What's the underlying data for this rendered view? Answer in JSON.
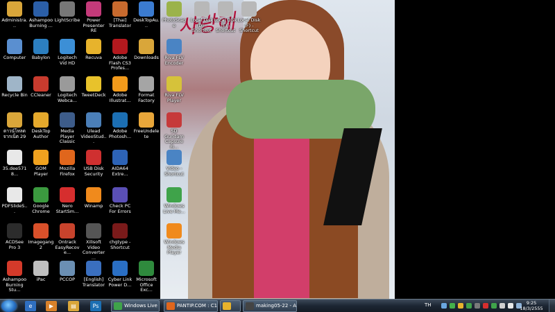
{
  "wallpaper": {
    "script_text": "사랑해"
  },
  "desktop_icons": [
    {
      "label": "Administra...",
      "icon": "folder-icon",
      "color": "#d9a63a"
    },
    {
      "label": "Computer",
      "icon": "computer-icon",
      "color": "#5a8fd0"
    },
    {
      "label": "Recycle Bin",
      "icon": "recycle-bin-icon",
      "color": "#9fb5c8"
    },
    {
      "label": "ดาวน์โหลดจากเน็ต 29",
      "icon": "folder-icon",
      "color": "#d9a63a"
    },
    {
      "label": "35.dee5718...",
      "icon": "document-icon",
      "color": "#e8e8e8"
    },
    {
      "label": "PDFSlideS...",
      "icon": "document-icon",
      "color": "#e8e8e8"
    },
    {
      "label": "ACDSee Pro 3",
      "icon": "acdsee-icon",
      "color": "#2c2c2c"
    },
    {
      "label": "Ashampoo Burning Stu...",
      "icon": "ashampoo-icon",
      "color": "#d43a2a"
    },
    {
      "label": "Ashampoo Burning ...",
      "icon": "ashampoo-icon",
      "color": "#2b5fa8"
    },
    {
      "label": "Babylon",
      "icon": "babylon-icon",
      "color": "#2c7fc0"
    },
    {
      "label": "CCleaner",
      "icon": "ccleaner-icon",
      "color": "#c83b2e"
    },
    {
      "label": "DeskTop Author",
      "icon": "desktop-author-icon",
      "color": "#e5a92c"
    },
    {
      "label": "GOM Player",
      "icon": "gom-player-icon",
      "color": "#f0a21f"
    },
    {
      "label": "Google Chrome",
      "icon": "chrome-icon",
      "color": "#3b9a3f"
    },
    {
      "label": "Imagegang2",
      "icon": "imagegang-icon",
      "color": "#d9502a"
    },
    {
      "label": "iPac",
      "icon": "ipac-icon",
      "color": "#bfbfbf"
    },
    {
      "label": "LightScribe",
      "icon": "lightscribe-icon",
      "color": "#777777"
    },
    {
      "label": "Logitech Vid HD",
      "icon": "logitech-icon",
      "color": "#3c8fd6"
    },
    {
      "label": "Logitech Webca...",
      "icon": "webcam-icon",
      "color": "#9a9a9a"
    },
    {
      "label": "Media Player Classic",
      "icon": "media-player-icon",
      "color": "#3d5c8a"
    },
    {
      "label": "Mozilla Firefox",
      "icon": "firefox-icon",
      "color": "#e0661c"
    },
    {
      "label": "Nero StartSm...",
      "icon": "nero-icon",
      "color": "#d62e2e"
    },
    {
      "label": "Ontrack EasyRecove...",
      "icon": "ontrack-icon",
      "color": "#c7432c"
    },
    {
      "label": "PCCOP",
      "icon": "pccop-icon",
      "color": "#6b8fb3"
    },
    {
      "label": "Power Presenter RE",
      "icon": "presenter-icon",
      "color": "#c43a7a"
    },
    {
      "label": "Recuva",
      "icon": "recuva-icon",
      "color": "#e7b32c"
    },
    {
      "label": "TweetDeck",
      "icon": "tweetdeck-icon",
      "color": "#e8c22b"
    },
    {
      "label": "Ulead VideoStud...",
      "icon": "ulead-icon",
      "color": "#4b7fb8"
    },
    {
      "label": "USB Disk Security",
      "icon": "usb-security-icon",
      "color": "#cf3030"
    },
    {
      "label": "Winamp",
      "icon": "winamp-icon",
      "color": "#f08a1c"
    },
    {
      "label": "Xilisoft Video Converter ...",
      "icon": "xilisoft-icon",
      "color": "#555555"
    },
    {
      "label": "[English] Translator",
      "icon": "translator-icon",
      "color": "#3a6fbf"
    },
    {
      "label": "[Thai] Translator",
      "icon": "translator-icon",
      "color": "#c86a2e"
    },
    {
      "label": "Adobe Flash CS3 Profes...",
      "icon": "flash-icon",
      "color": "#b3191e"
    },
    {
      "label": "Adobe Illustrat...",
      "icon": "illustrator-icon",
      "color": "#f29a1b"
    },
    {
      "label": "Adobe Photosh...",
      "icon": "photoshop-icon",
      "color": "#1c6fb3"
    },
    {
      "label": "AIDA64 Extre...",
      "icon": "aida64-icon",
      "color": "#2d63b6"
    },
    {
      "label": "Check PC For Errors",
      "icon": "checkpc-icon",
      "color": "#5a4fb5"
    },
    {
      "label": "chgtype - Shortcut",
      "icon": "chgtype-icon",
      "color": "#7a1a1a"
    },
    {
      "label": "Cyber Link Power D...",
      "icon": "cyberlink-icon",
      "color": "#2a6fc4"
    },
    {
      "label": "DeskTopAu...",
      "icon": "desktop-author-icon",
      "color": "#3b7bd0"
    },
    {
      "label": "Downloads",
      "icon": "folder-icon",
      "color": "#d9a63a"
    },
    {
      "label": "Format Factory",
      "icon": "format-factory-icon",
      "color": "#a5a5a5"
    },
    {
      "label": "FreeUndelete",
      "icon": "freeundelete-icon",
      "color": "#e8a63a"
    },
    {
      "label": "Microsoft Office Exc...",
      "icon": "excel-icon",
      "color": "#2f8a3d"
    },
    {
      "label": "PhotoScape",
      "icon": "photoscape-icon",
      "color": "#9bb34a"
    },
    {
      "label": "Local Disk (D) - Shortcut",
      "icon": "drive-icon",
      "color": "#b8b8b8"
    },
    {
      "label": "Local Disk (E) - Shortcut",
      "icon": "drive-icon",
      "color": "#b8b8b8"
    },
    {
      "label": "Local Disk (F) - Shortcut",
      "icon": "drive-icon",
      "color": "#b8b8b8"
    },
    {
      "label": "Riva FLV Encoder",
      "icon": "riva-icon",
      "color": "#4a84c4"
    },
    {
      "label": "Riva FLV Player",
      "icon": "riva-player-icon",
      "color": "#d6c23a"
    },
    {
      "label": "SD Gundam Capsule Fi...",
      "icon": "gundam-icon",
      "color": "#c63a3a"
    },
    {
      "label": "Video - Shortcut",
      "icon": "video-icon",
      "color": "#4a84c4"
    },
    {
      "label": "Windows Live Me...",
      "icon": "messenger-icon",
      "color": "#3fa34a"
    },
    {
      "label": "Windows Media Player",
      "icon": "wmp-icon",
      "color": "#f08a1c"
    }
  ],
  "taskbar": {
    "tasks": [
      {
        "label": "Windows Live Me...",
        "color": "#3fa34a"
      },
      {
        "label": "PANTIP.COM : C1...",
        "color": "#e0661c"
      },
      {
        "label": "",
        "color": "#e7b32c"
      },
      {
        "label": "making05-22 - A...",
        "color": "#444444"
      }
    ],
    "language": "TH",
    "clock_time": "9:25",
    "clock_date": "18/3/2555"
  }
}
